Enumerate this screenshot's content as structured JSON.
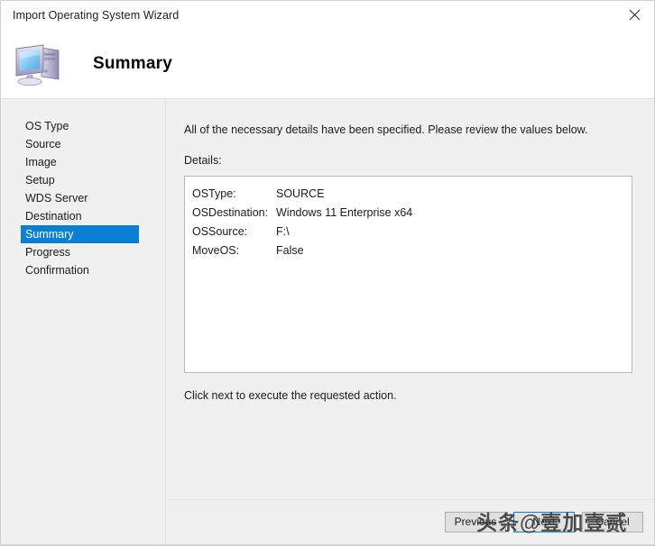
{
  "window": {
    "title": "Import Operating System Wizard",
    "close_icon": "close-icon"
  },
  "banner": {
    "title": "Summary",
    "icon": "computer-icon"
  },
  "sidebar": {
    "items": [
      {
        "label": "OS Type",
        "selected": false
      },
      {
        "label": "Source",
        "selected": false
      },
      {
        "label": "Image",
        "selected": false
      },
      {
        "label": "Setup",
        "selected": false
      },
      {
        "label": "WDS Server",
        "selected": false
      },
      {
        "label": "Destination",
        "selected": false
      },
      {
        "label": "Summary",
        "selected": true
      },
      {
        "label": "Progress",
        "selected": false
      },
      {
        "label": "Confirmation",
        "selected": false
      }
    ]
  },
  "content": {
    "intro": "All of the necessary details have been specified.  Please review the values below.",
    "details_label": "Details:",
    "details": [
      {
        "key": "OSType:",
        "value": "SOURCE"
      },
      {
        "key": "OSDestination:",
        "value": "Windows 11 Enterprise x64"
      },
      {
        "key": "OSSource:",
        "value": "F:\\"
      },
      {
        "key": "MoveOS:",
        "value": "False"
      }
    ],
    "footer_note": "Click next to execute the requested action."
  },
  "buttons": {
    "previous": "Previous",
    "next": "Next",
    "cancel": "Cancel"
  },
  "watermark": {
    "text": "头条@壹加壹贰"
  },
  "colors": {
    "selection_blue": "#0a7fd4",
    "panel_gray": "#f0f0f0",
    "box_border": "#b8b8b8"
  }
}
